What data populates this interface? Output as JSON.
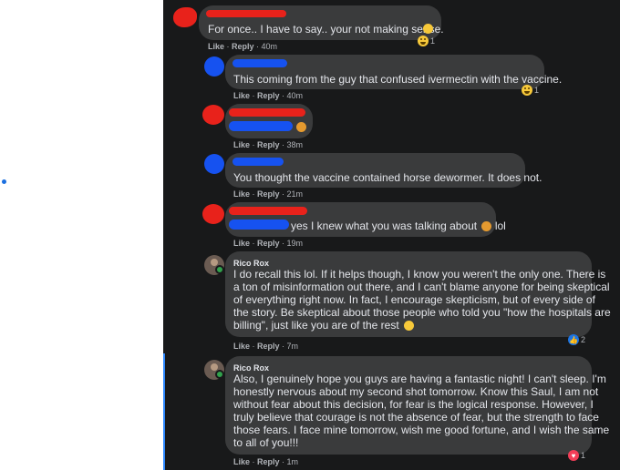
{
  "colors": {
    "background": "#18191a",
    "bubble": "#3a3b3c",
    "text": "#e4e6eb",
    "meta": "#b0b3b8",
    "redacted_red": "#e8221b",
    "redacted_blue": "#1652f0",
    "like_blue": "#1b74e4",
    "love_red": "#f33e58"
  },
  "comments": [
    {
      "text": "For once.. I have to say.. your not making sense.",
      "like": "Like",
      "reply": "Reply",
      "time": "40m",
      "reaction_icon": "haha-emoji-icon",
      "reaction_count": "1"
    },
    {
      "text": "This coming from the guy that confused ivermectin with the vaccine.",
      "like": "Like",
      "reply": "Reply",
      "time": "40m",
      "reaction_icon": "haha-emoji-icon",
      "reaction_count": "1"
    },
    {
      "text": "",
      "like": "Like",
      "reply": "Reply",
      "time": "38m"
    },
    {
      "text": "You thought the vaccine contained horse dewormer. It does not.",
      "like": "Like",
      "reply": "Reply",
      "time": "21m"
    },
    {
      "text": "yes I knew what you was talking about",
      "text_suffix": "lol",
      "like": "Like",
      "reply": "Reply",
      "time": "19m"
    },
    {
      "author": "Rico Rox",
      "lines": [
        "I do recall this lol. If it helps though, I know you weren't the only one. There is",
        "a ton of misinformation out there, and I can't blame anyone for being skeptical",
        "of everything right now. In fact, I encourage skepticism, but of every side of",
        "the story. Be skeptical about those people who told you \"how the hospitals are",
        "billing\", just like you are of the rest"
      ],
      "like": "Like",
      "reply": "Reply",
      "time": "7m",
      "reaction_icon": "like-thumb-icon",
      "reaction_count": "2"
    },
    {
      "author": "Rico Rox",
      "lines": [
        "Also, I genuinely hope you guys are having a fantastic night! I can't sleep. I'm",
        "honestly nervous about my second shot tomorrow. Know this Saul, I am not",
        "without fear about this decision, for fear is the logical response. However, I",
        "truly believe that courage is not the absence of fear, but the strength to face",
        "those fears. I face mine tomorrow, wish me good fortune, and I wish the same",
        "to all of you!!!"
      ],
      "like": "Like",
      "reply": "Reply",
      "time": "1m",
      "reaction_icon": "love-heart-icon",
      "reaction_count": "1"
    }
  ]
}
